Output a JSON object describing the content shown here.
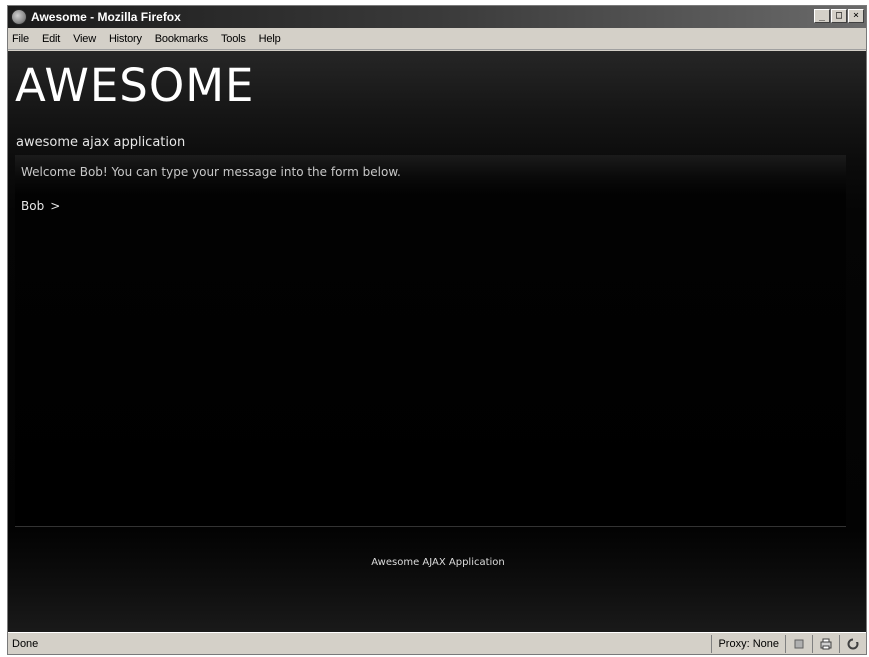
{
  "window": {
    "title": "Awesome - Mozilla Firefox",
    "controls": [
      "_",
      "□",
      "×"
    ]
  },
  "menubar": {
    "items": [
      "File",
      "Edit",
      "View",
      "History",
      "Bookmarks",
      "Tools",
      "Help"
    ]
  },
  "app": {
    "title": "AWESOME",
    "subtitle": "awesome ajax application",
    "welcome": "Welcome Bob! You can type your message into the form below.",
    "prompt_name": "Bob",
    "prompt_symbol": ">",
    "input_value": "",
    "footer": "Awesome AJAX Application"
  },
  "statusbar": {
    "status": "Done",
    "proxy": "Proxy: None",
    "icons": [
      "notification-icon",
      "printer-icon",
      "reload-icon"
    ]
  },
  "colors": {
    "background": "#000000",
    "text": "#ffffff",
    "chrome": "#d4d0c8"
  }
}
